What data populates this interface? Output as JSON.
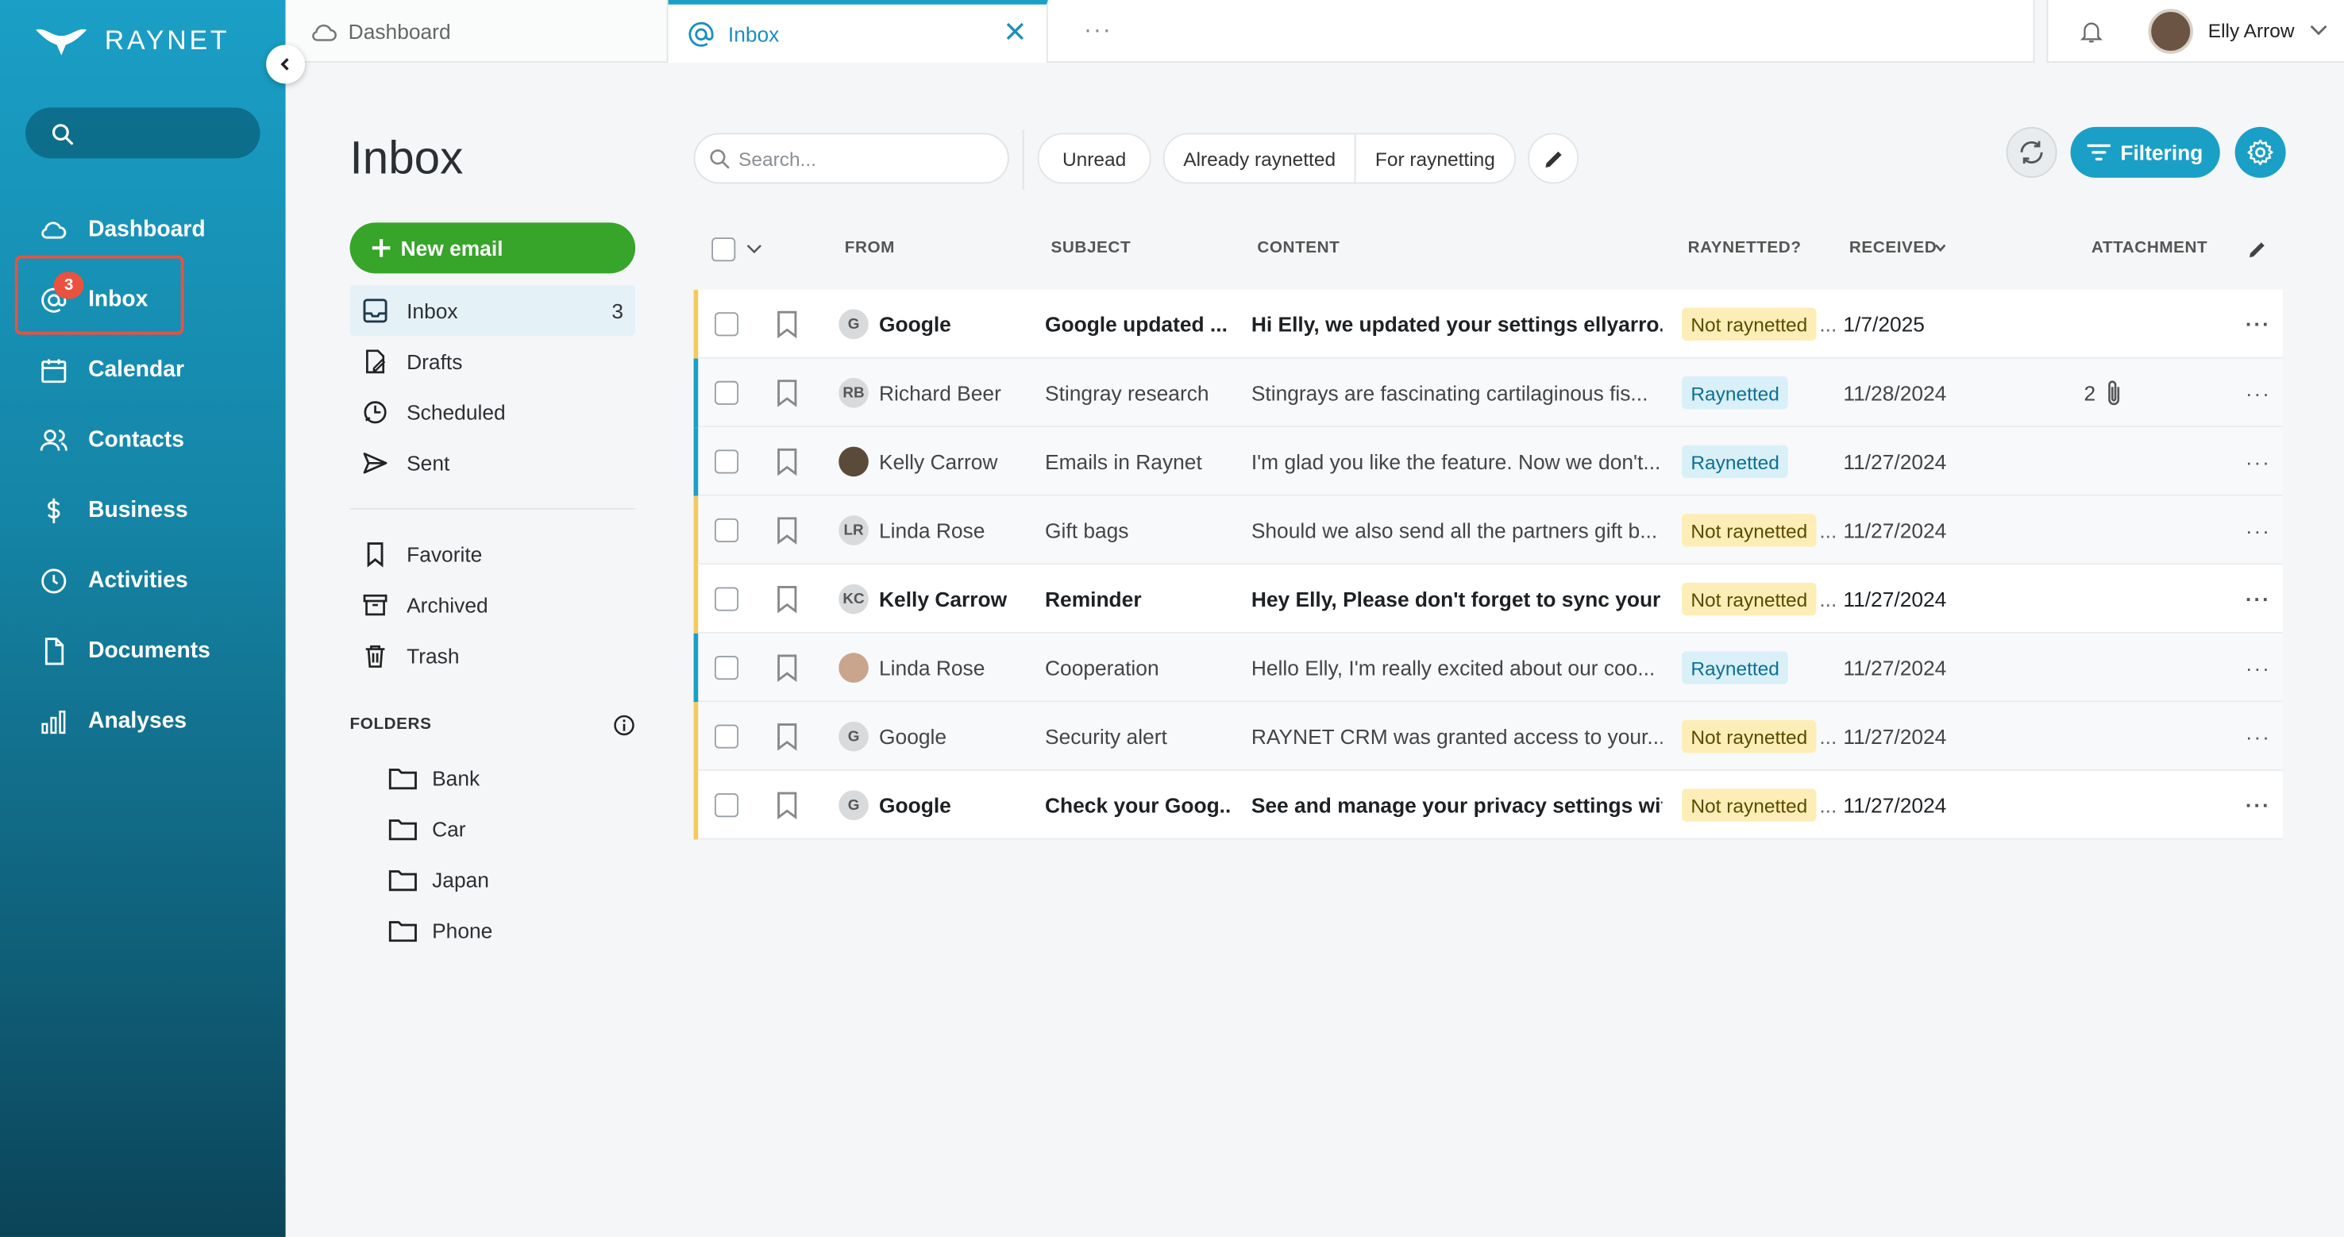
{
  "app": {
    "name": "RAYNET"
  },
  "sidebar": {
    "items": [
      {
        "label": "Dashboard",
        "icon": "cloud-icon"
      },
      {
        "label": "Inbox",
        "icon": "at-icon",
        "badge": "3"
      },
      {
        "label": "Calendar",
        "icon": "calendar-icon"
      },
      {
        "label": "Contacts",
        "icon": "contacts-icon"
      },
      {
        "label": "Business",
        "icon": "dollar-icon"
      },
      {
        "label": "Activities",
        "icon": "clock-icon"
      },
      {
        "label": "Documents",
        "icon": "document-icon"
      },
      {
        "label": "Analyses",
        "icon": "bar-chart-icon"
      }
    ]
  },
  "tabs": [
    {
      "label": "Dashboard",
      "icon": "cloud-icon"
    },
    {
      "label": "Inbox",
      "icon": "at-icon",
      "active": true
    },
    {
      "label": "···"
    }
  ],
  "user": {
    "name": "Elly Arrow"
  },
  "page": {
    "title": "Inbox",
    "new_email": "New email"
  },
  "mailboxes": [
    {
      "label": "Inbox",
      "count": "3",
      "icon": "inbox-icon"
    },
    {
      "label": "Drafts",
      "icon": "draft-icon"
    },
    {
      "label": "Scheduled",
      "icon": "scheduled-icon"
    },
    {
      "label": "Sent",
      "icon": "send-icon"
    }
  ],
  "categories": [
    {
      "label": "Favorite",
      "icon": "bookmark-icon"
    },
    {
      "label": "Archived",
      "icon": "archive-icon"
    },
    {
      "label": "Trash",
      "icon": "trash-icon"
    }
  ],
  "folders": {
    "heading": "FOLDERS",
    "items": [
      "Bank",
      "Car",
      "Japan",
      "Phone"
    ]
  },
  "toolbar": {
    "search_placeholder": "Search...",
    "chips": [
      "Unread",
      "Already raynetted",
      "For raynetting"
    ],
    "filter_label": "Filtering"
  },
  "table": {
    "columns": [
      "FROM",
      "SUBJECT",
      "CONTENT",
      "RAYNETTED?",
      "RECEIVED",
      "ATTACHMENT"
    ],
    "rows": [
      {
        "unread": true,
        "avatar": "G",
        "from": "Google",
        "subject": "Google updated ...",
        "content": "Hi Elly, we updated your settings ellyarro...",
        "status": "Not raynetted",
        "status_suffix": "...",
        "received": "1/7/2025",
        "attachment": ""
      },
      {
        "unread": false,
        "avatar": "RB",
        "from": "Richard Beer",
        "subject": "Stingray research",
        "content": "Stingrays are fascinating cartilaginous fis...",
        "status": "Raynetted",
        "status_suffix": "",
        "received": "11/28/2024",
        "attachment": "2"
      },
      {
        "unread": false,
        "avatar": "photo",
        "from": "Kelly Carrow",
        "subject": "Emails in Raynet",
        "content": "I'm glad you like the feature. Now we don't...",
        "status": "Raynetted",
        "status_suffix": "",
        "received": "11/27/2024",
        "attachment": ""
      },
      {
        "unread": false,
        "avatar": "LR",
        "from": "Linda Rose",
        "subject": "Gift bags",
        "content": "Should we also send all the partners gift b...",
        "status": "Not raynetted",
        "status_suffix": "...",
        "received": "11/27/2024",
        "attachment": ""
      },
      {
        "unread": true,
        "avatar": "KC",
        "from": "Kelly Carrow",
        "subject": "Reminder",
        "content": "Hey Elly, Please don't forget to sync your ...",
        "status": "Not raynetted",
        "status_suffix": "...",
        "received": "11/27/2024",
        "attachment": ""
      },
      {
        "unread": false,
        "avatar": "photo2",
        "from": "Linda Rose",
        "subject": "Cooperation",
        "content": "Hello Elly, I'm really excited about our coo...",
        "status": "Raynetted",
        "status_suffix": "",
        "received": "11/27/2024",
        "attachment": ""
      },
      {
        "unread": false,
        "avatar": "G",
        "from": "Google",
        "subject": "Security alert",
        "content": "RAYNET CRM was granted access to your...",
        "status": "Not raynetted",
        "status_suffix": "...",
        "received": "11/27/2024",
        "attachment": ""
      },
      {
        "unread": true,
        "avatar": "G",
        "from": "Google",
        "subject": "Check your Goog...",
        "content": "See and manage your privacy settings wit...",
        "status": "Not raynetted",
        "status_suffix": "...",
        "received": "11/27/2024",
        "attachment": ""
      }
    ]
  },
  "colors": {
    "accent": "#1a9fc6",
    "new_email": "#36a52a",
    "not_raynetted": "#fdeeb7",
    "raynetted": "#d9f0f8",
    "bar_not": "#f4c95d",
    "bar_yes": "#1a9fc6",
    "highlight": "#e8523f"
  }
}
